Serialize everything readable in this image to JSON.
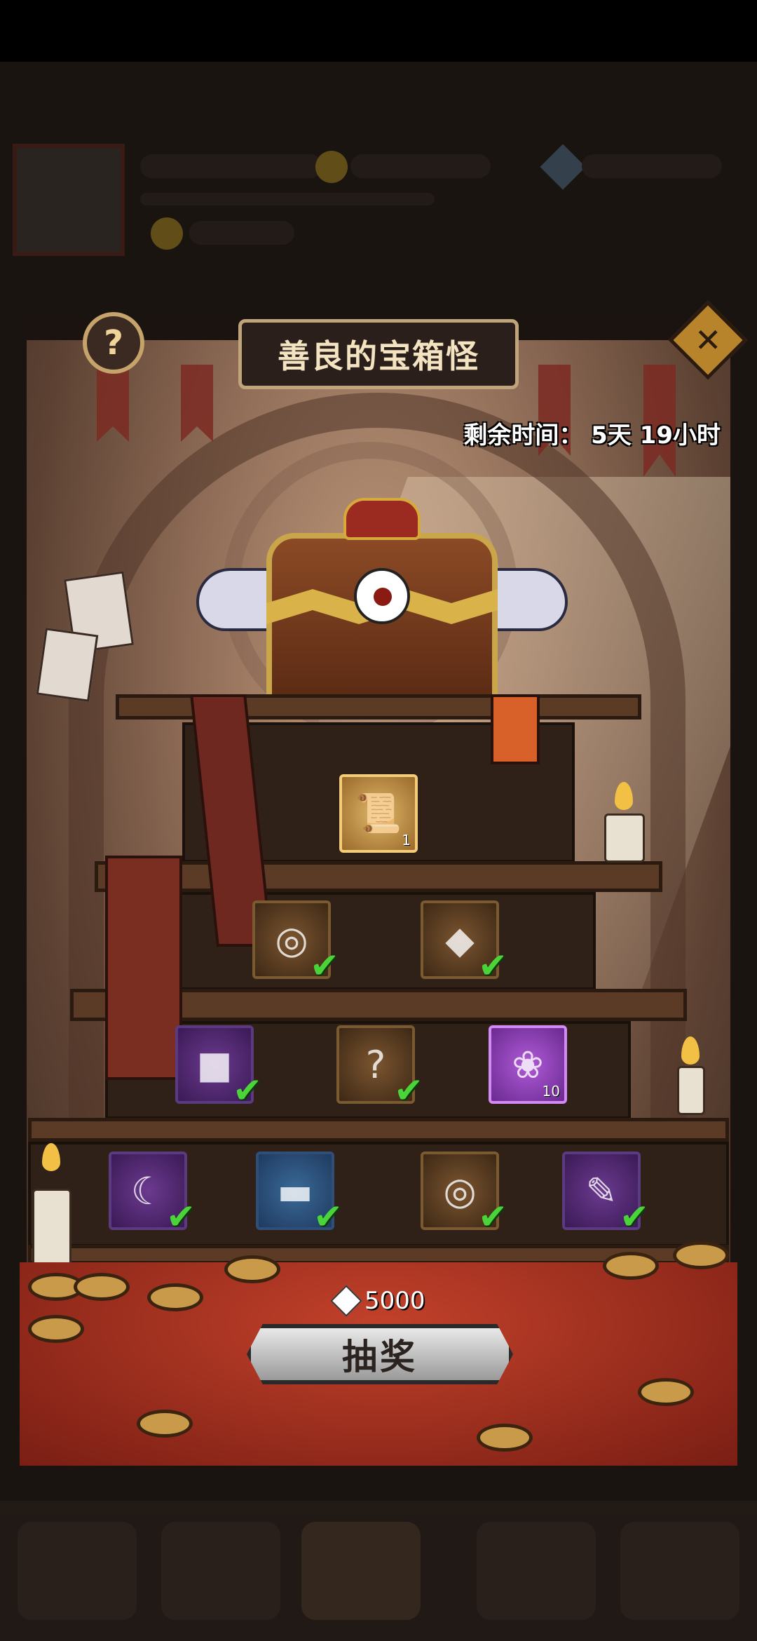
{
  "modal": {
    "title": "善良的宝箱怪",
    "help_label": "?",
    "close_label": "✕",
    "timer": "剩余时间：  5天 19小时"
  },
  "rewards": [
    {
      "tier": 1,
      "qty": "1",
      "claimed": false,
      "style": "gold",
      "icon": "scroll-icon"
    },
    {
      "tier": 2,
      "qty": "",
      "claimed": true,
      "style": "brown",
      "icon": "compass-icon"
    },
    {
      "tier": 2,
      "qty": "",
      "claimed": true,
      "style": "brown",
      "icon": "gem-box-icon"
    },
    {
      "tier": 3,
      "qty": "",
      "claimed": true,
      "style": "purple",
      "icon": "box-icon"
    },
    {
      "tier": 3,
      "qty": "",
      "claimed": true,
      "style": "brown",
      "icon": "mystery-icon"
    },
    {
      "tier": 3,
      "qty": "10",
      "claimed": false,
      "style": "violet",
      "icon": "charm-icon"
    },
    {
      "tier": 4,
      "qty": "",
      "claimed": true,
      "style": "purple",
      "icon": "amulet-icon"
    },
    {
      "tier": 4,
      "qty": "",
      "claimed": true,
      "style": "blue",
      "icon": "book-icon"
    },
    {
      "tier": 4,
      "qty": "",
      "claimed": true,
      "style": "brown",
      "icon": "compass-icon"
    },
    {
      "tier": 4,
      "qty": "",
      "claimed": true,
      "style": "purple",
      "icon": "scroll-icon"
    }
  ],
  "draw": {
    "cost": "5000",
    "label": "抽奖"
  }
}
